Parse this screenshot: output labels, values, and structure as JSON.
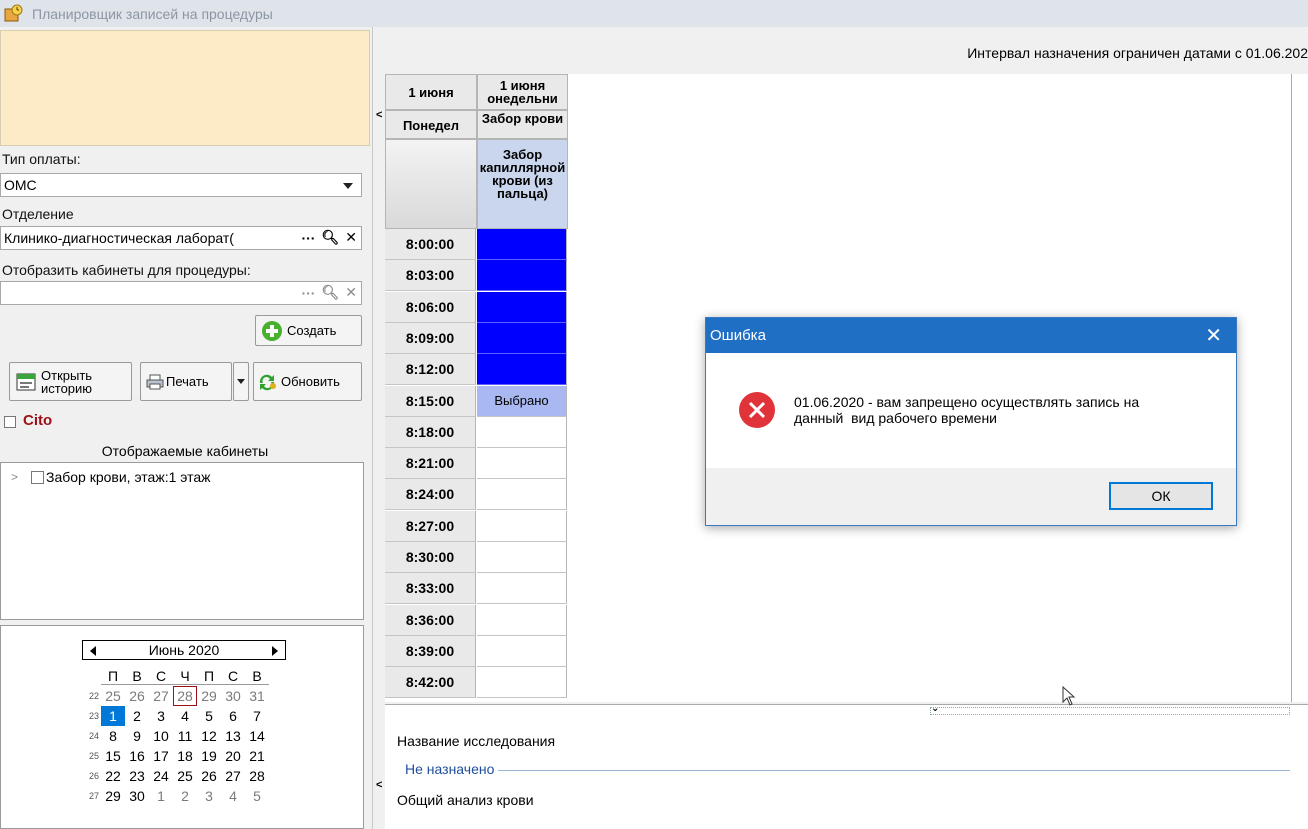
{
  "window": {
    "title": "Планировщик записей на процедуры"
  },
  "left": {
    "payment_label": "Тип оплаты:",
    "payment_value": "ОМС",
    "department_label": "Отделение",
    "department_value": "Клинико-диагностическая лаборат(",
    "rooms_for_procedure_label": "Отобразить кабинеты для процедуры:",
    "rooms_for_procedure_value": "",
    "create_label": "Создать",
    "open_history_label_1": "Открыть",
    "open_history_label_2": "историю",
    "print_label": "Печать",
    "refresh_label": "Обновить",
    "cito_label": "Cito",
    "rooms_title": "Отображаемые кабинеты",
    "rooms": [
      {
        "label": "Забор крови, этаж:1 этаж"
      }
    ]
  },
  "calendar": {
    "month": "Июнь 2020",
    "weekdays": [
      "П",
      "В",
      "С",
      "Ч",
      "П",
      "С",
      "В"
    ],
    "weeks": [
      {
        "num": "22",
        "days": [
          "25",
          "26",
          "27",
          "28",
          "29",
          "30",
          "31"
        ]
      },
      {
        "num": "23",
        "days": [
          "1",
          "2",
          "3",
          "4",
          "5",
          "6",
          "7"
        ]
      },
      {
        "num": "24",
        "days": [
          "8",
          "9",
          "10",
          "11",
          "12",
          "13",
          "14"
        ]
      },
      {
        "num": "25",
        "days": [
          "15",
          "16",
          "17",
          "18",
          "19",
          "20",
          "21"
        ]
      },
      {
        "num": "26",
        "days": [
          "22",
          "23",
          "24",
          "25",
          "26",
          "27",
          "28"
        ]
      },
      {
        "num": "27",
        "days": [
          "29",
          "30",
          "1",
          "2",
          "3",
          "4",
          "5"
        ]
      }
    ],
    "today": "28",
    "selected": "1"
  },
  "schedule": {
    "interval_text": "Интервал назначения ограничен датами с 01.06.202",
    "header": {
      "date_left": "1 июня",
      "date_right_1": "1 июня",
      "date_right_2": "онедельни",
      "weekday_left": "Понедел",
      "cabinet": "Забор крови",
      "procedure": "Забор капиллярной крови (из пальца)"
    },
    "times": [
      "8:00:00",
      "8:03:00",
      "8:06:00",
      "8:09:00",
      "8:12:00",
      "8:15:00",
      "8:18:00",
      "8:21:00",
      "8:24:00",
      "8:27:00",
      "8:30:00",
      "8:33:00",
      "8:36:00",
      "8:39:00",
      "8:42:00"
    ],
    "slots": [
      "",
      "",
      "",
      "",
      "",
      "Выбрано",
      "",
      "",
      "",
      "",
      "",
      "",
      "",
      "",
      ""
    ],
    "slot_states": [
      "busy",
      "busy",
      "busy",
      "busy",
      "busy",
      "selected",
      "free",
      "free",
      "free",
      "free",
      "free",
      "free",
      "free",
      "free",
      "free"
    ],
    "colors": {
      "busy": "#0000ff",
      "selected": "#a9b8f0",
      "free": "#ffffff"
    }
  },
  "bottom": {
    "study_label": "Название исследования",
    "group_title": "Не назначено",
    "study_item": "Общий анализ крови"
  },
  "dialog": {
    "title": "Ошибка",
    "message": "01.06.2020 - вам запрещено осуществлять запись на\nданный  вид рабочего времени",
    "ok_label": "ОК"
  }
}
